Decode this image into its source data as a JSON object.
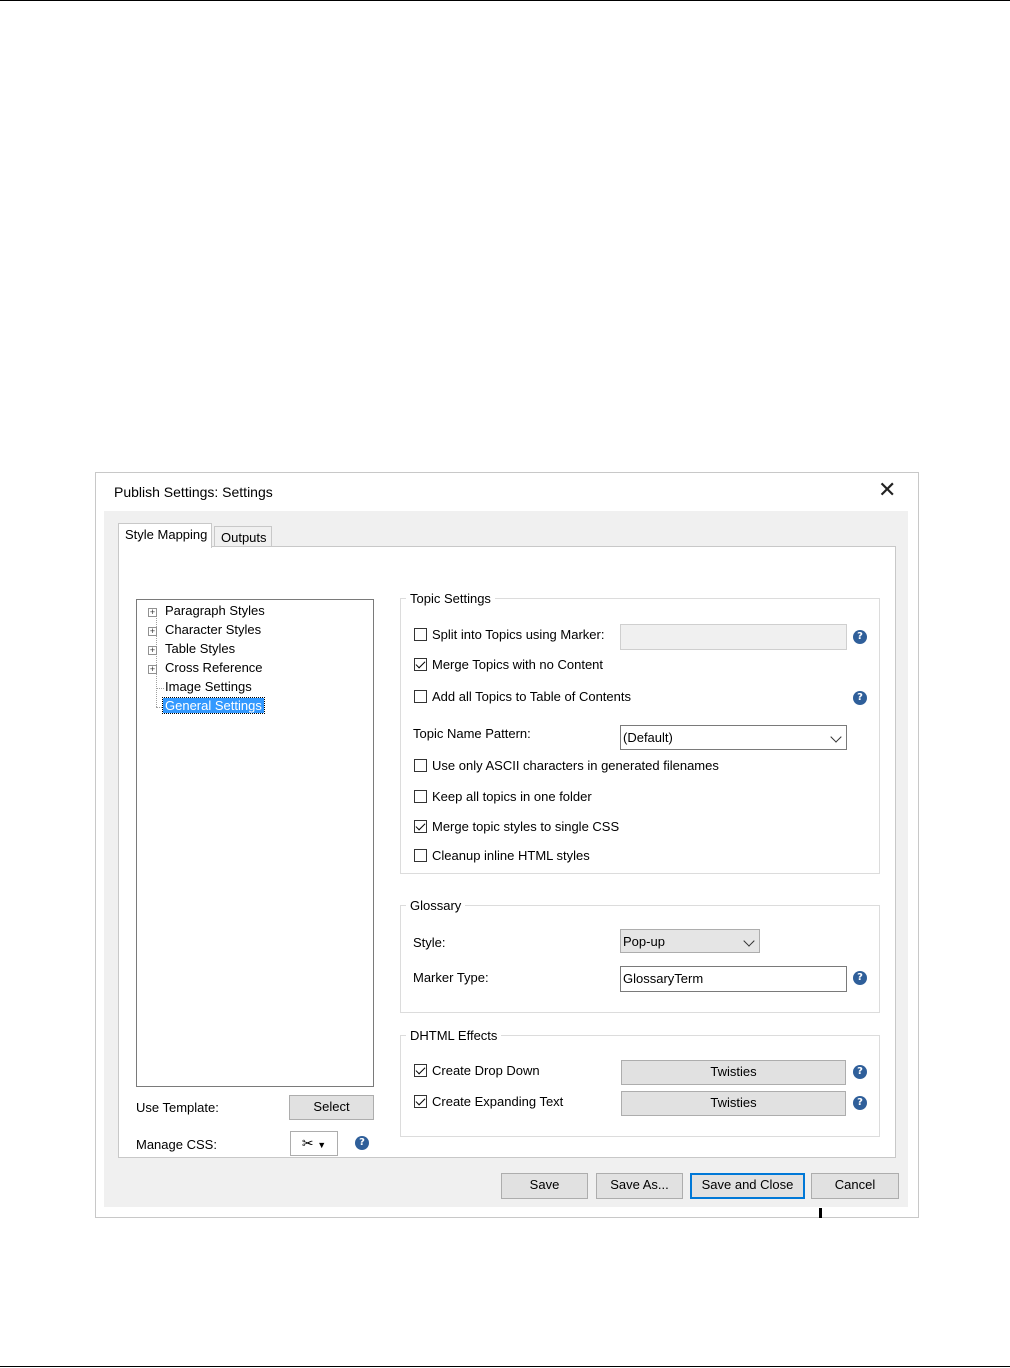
{
  "dialog": {
    "title": "Publish Settings: Settings",
    "close_icon": "close-icon"
  },
  "tabs": [
    {
      "label": "Style Mapping",
      "active": true
    },
    {
      "label": "Outputs",
      "active": false
    }
  ],
  "tree": {
    "items": [
      {
        "label": "Paragraph Styles",
        "expandable": true
      },
      {
        "label": "Character Styles",
        "expandable": true
      },
      {
        "label": "Table Styles",
        "expandable": true
      },
      {
        "label": "Cross Reference",
        "expandable": true
      },
      {
        "label": "Image Settings",
        "expandable": false
      },
      {
        "label": "General Settings",
        "expandable": false,
        "selected": true
      }
    ]
  },
  "template": {
    "use_template_label": "Use Template:",
    "select_button": "Select",
    "manage_css_label": "Manage CSS:",
    "manage_css_icon": "tools-icon"
  },
  "topic_settings": {
    "title": "Topic Settings",
    "split_label": "Split into Topics using Marker:",
    "split_checked": false,
    "split_value": "",
    "merge_label": "Merge Topics with no Content",
    "merge_checked": true,
    "add_toc_label": "Add all Topics to Table of Contents",
    "add_toc_checked": false,
    "name_pattern_label": "Topic Name Pattern:",
    "name_pattern_value": "(Default)",
    "ascii_label": "Use only ASCII characters in generated filenames",
    "ascii_checked": false,
    "keep_folder_label": "Keep all topics in one folder",
    "keep_folder_checked": false,
    "merge_css_label": "Merge topic styles to single CSS",
    "merge_css_checked": true,
    "cleanup_label": "Cleanup inline HTML styles",
    "cleanup_checked": false
  },
  "glossary": {
    "title": "Glossary",
    "style_label": "Style:",
    "style_value": "Pop-up",
    "marker_type_label": "Marker Type:",
    "marker_type_value": "GlossaryTerm"
  },
  "dhtml": {
    "title": "DHTML Effects",
    "drop_down_label": "Create Drop Down",
    "drop_down_checked": true,
    "drop_down_button": "Twisties",
    "expanding_label": "Create Expanding Text",
    "expanding_checked": true,
    "expanding_button": "Twisties"
  },
  "footer": {
    "save": "Save",
    "save_as": "Save As...",
    "save_close": "Save and Close",
    "cancel": "Cancel"
  },
  "help_glyph": "?"
}
